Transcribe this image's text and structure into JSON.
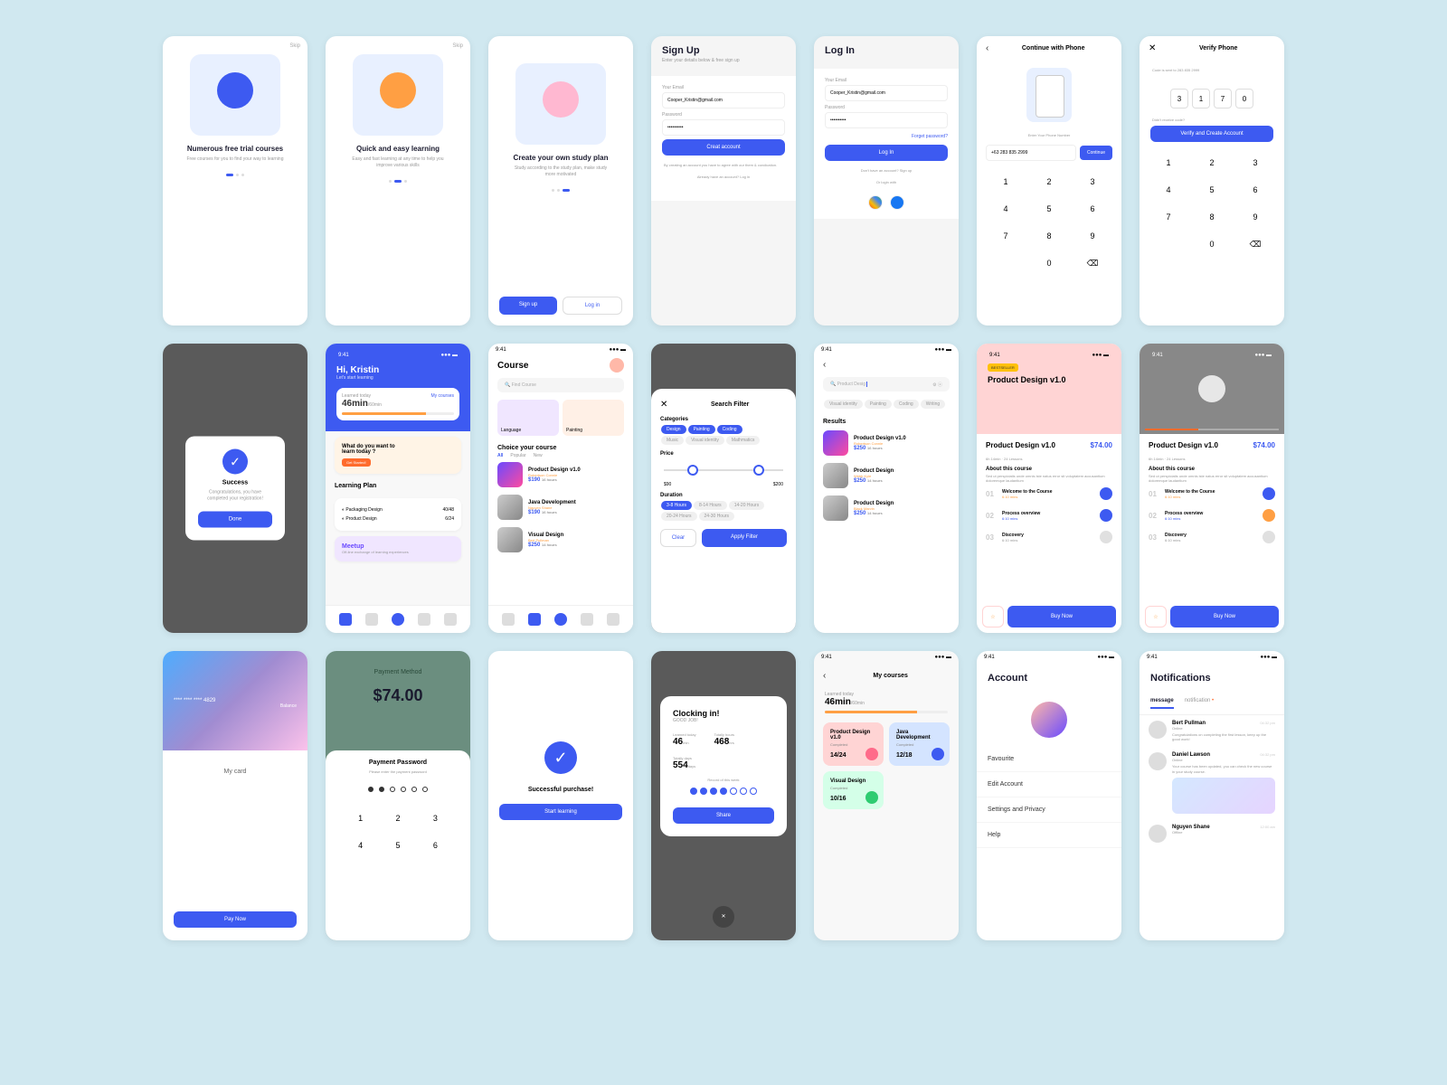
{
  "onb1": {
    "skip": "Skip",
    "title": "Numerous free trial courses",
    "sub": "Free courses for you to find your way to learning"
  },
  "onb2": {
    "skip": "Skip",
    "title": "Quick and easy learning",
    "sub": "Easy and fast learning at any time to help you improve various skills"
  },
  "onb3": {
    "title": "Create your own study plan",
    "sub": "Study according to the study plan, make study more motivated",
    "signup": "Sign up",
    "login": "Log in"
  },
  "signup": {
    "title": "Sign Up",
    "sub": "Enter your details below & free sign up",
    "email_label": "Your Email",
    "email": "Cooper_Kristin@gmail.com",
    "pwd_label": "Password",
    "pwd": "••••••••••",
    "btn": "Creat account",
    "terms": "By creating an account you have to agree with our them & condication.",
    "already": "Already have an account? Log in"
  },
  "login": {
    "title": "Log In",
    "email_label": "Your Email",
    "email": "Cooper_Kristin@gmail.com",
    "pwd_label": "Password",
    "pwd": "••••••••••",
    "forgot": "Forget password?",
    "btn": "Log In",
    "noacct": "Don't have an account? Sign up",
    "orlogin": "Or login with"
  },
  "phone": {
    "title": "Continue with Phone",
    "enter": "Enter Your Phone Number",
    "number": "+63 283 835 2999",
    "continue": "Continue",
    "keys": [
      "1",
      "2",
      "3",
      "4",
      "5",
      "6",
      "7",
      "8",
      "9",
      "",
      "0",
      "⌫"
    ]
  },
  "verify": {
    "title": "Verify Phone",
    "sent": "Code is sent to 283 835 2999",
    "otp": [
      "3",
      "1",
      "7",
      "0"
    ],
    "resend": "Didn't receive code?",
    "btn": "Verify and Create Account",
    "keys": [
      "1",
      "2",
      "3",
      "4",
      "5",
      "6",
      "7",
      "8",
      "9",
      "",
      "0",
      "⌫"
    ]
  },
  "success": {
    "title": "Success",
    "msg": "Congratulations, you have completed your registration!",
    "btn": "Done"
  },
  "home": {
    "time": "9:41",
    "greet": "Hi, Kristin",
    "sub": "Let's start learning",
    "learned_label": "Learned today",
    "mycourses": "My courses",
    "learned": "46min",
    "total": "/60min",
    "promo_title": "What do you want to learn today ?",
    "promo_btn": "Get Started!",
    "plan_title": "Learning Plan",
    "plans": [
      {
        "name": "Packaging Design",
        "progress": "40/48"
      },
      {
        "name": "Product Design",
        "progress": "6/24"
      }
    ],
    "meetup_title": "Meetup",
    "meetup_sub": "Off-line exchange of learning experiences"
  },
  "course": {
    "time": "9:41",
    "title": "Course",
    "search": "Find Course",
    "cat1": "Language",
    "cat2": "Painting",
    "choice": "Choice your course",
    "tabs": [
      "All",
      "Popular",
      "New"
    ],
    "items": [
      {
        "name": "Product Design v1.0",
        "author": "Robertson Connie",
        "price": "$190",
        "hours": "16 hours"
      },
      {
        "name": "Java Development",
        "author": "Nguyen Shane",
        "price": "$190",
        "hours": "16 hours"
      },
      {
        "name": "Visual Design",
        "author": "Bert Pullman",
        "price": "$250",
        "hours": "14 hours"
      }
    ]
  },
  "filter": {
    "title": "Search Filter",
    "cat_title": "Categories",
    "cats": [
      "Design",
      "Painting",
      "Coding",
      "Music",
      "Visual identity",
      "Mathmatics"
    ],
    "price_title": "Price",
    "min": "$90",
    "max": "$200",
    "dur_title": "Duration",
    "durs": [
      "3-8 Hours",
      "8-14 Hours",
      "14-20 Hours",
      "20-24 Hours",
      "24-30 Hours"
    ],
    "clear": "Clear",
    "apply": "Apply Filter"
  },
  "search": {
    "time": "9:41",
    "query": "Product Desig",
    "chips": [
      "Visual identity",
      "Painting",
      "Coding",
      "Writing"
    ],
    "results_title": "Results",
    "items": [
      {
        "name": "Product Design v1.0",
        "author": "Robertson Connie",
        "price": "$250",
        "hours": "16 hours"
      },
      {
        "name": "Product Design",
        "author": "Webb Kyle",
        "price": "$250",
        "hours": "14 hours"
      },
      {
        "name": "Product Design",
        "author": "Black Marvin",
        "price": "$250",
        "hours": "14 hours"
      }
    ]
  },
  "detail": {
    "time": "9:41",
    "badge": "BESTSELLER",
    "hero_title": "Product Design v1.0",
    "title": "Product Design v1.0",
    "author": "6h 14min · 24 Lessons",
    "price": "$74.00",
    "about_title": "About this course",
    "about": "Sed ut perspiciatis unde omnis iste natus error sit voluptatem accusantium doloremque laudantium",
    "lessons": [
      {
        "n": "01",
        "t": "Welcome to the Course",
        "d": "6:10 mins"
      },
      {
        "n": "02",
        "t": "Process overview",
        "d": "6:10 mins"
      },
      {
        "n": "03",
        "t": "Discovery",
        "d": "6:10 mins"
      }
    ],
    "buy": "Buy Now"
  },
  "detail2": {
    "time": "9:41",
    "title": "Product Design v1.0",
    "author": "6h 14min · 24 Lessons",
    "price": "$74.00",
    "about_title": "About this course",
    "about": "Sed ut perspiciatis unde omnis iste natus error sit voluptatem accusantium doloremque laudantium",
    "lessons": [
      {
        "n": "01",
        "t": "Welcome to the Course",
        "d": "6:10 mins"
      },
      {
        "n": "02",
        "t": "Process overview",
        "d": "6:10 mins"
      },
      {
        "n": "03",
        "t": "Discovery",
        "d": "6:10 mins"
      }
    ],
    "buy": "Buy Now"
  },
  "card": {
    "digits": "**** **** **** 4829",
    "balance": "Balance",
    "mycard": "My card",
    "pay": "Pay Now"
  },
  "payment": {
    "title": "Payment Method",
    "price": "$74.00",
    "pwd_title": "Payment Password",
    "pwd_sub": "Please enter the payment password",
    "keys": [
      "1",
      "2",
      "3",
      "4",
      "5",
      "6"
    ]
  },
  "purchase": {
    "title": "Successful purchase!",
    "btn": "Start learning"
  },
  "clock": {
    "title": "Clocking in!",
    "sub": "GOOD JOB!",
    "l1": "Learned today",
    "v1": "46",
    "u1": "min",
    "l2": "Totally hours",
    "v2": "468",
    "u2": "hrs",
    "l3": "Totally days",
    "v3": "554",
    "u3": "days",
    "week": "Record of this week",
    "share": "Share"
  },
  "mycourses": {
    "time": "9:41",
    "title": "My courses",
    "learned_label": "Learned today",
    "learned": "46min",
    "total": "/60min",
    "items": [
      {
        "name": "Product Design v1.0",
        "status": "Completed",
        "val": "14/24",
        "color": "#ffd4d4",
        "play": "#ff6b8a"
      },
      {
        "name": "Java Development",
        "status": "Completed",
        "val": "12/18",
        "color": "#d4e4ff",
        "play": "#3d5af1"
      },
      {
        "name": "Visual Design",
        "status": "Completed",
        "val": "10/16",
        "color": "#d4ffe8",
        "play": "#2ecc71"
      }
    ]
  },
  "account": {
    "time": "9:41",
    "title": "Account",
    "items": [
      "Favourite",
      "Edit Account",
      "Settings and Privacy",
      "Help"
    ]
  },
  "notifications": {
    "time": "9:41",
    "title": "Notifications",
    "tabs": [
      "message",
      "notification"
    ],
    "items": [
      {
        "name": "Bert Pullman",
        "status": "Online",
        "time": "04:32 pm",
        "msg": "Congratulations on completing the first lesson, keep up the good work!"
      },
      {
        "name": "Daniel Lawson",
        "status": "Online",
        "time": "04:32 pm",
        "msg": "Your course has been updated, you can check the new course in your study course.",
        "img": true
      },
      {
        "name": "Nguyen Shane",
        "status": "Offline",
        "time": "12:00 am"
      }
    ]
  }
}
